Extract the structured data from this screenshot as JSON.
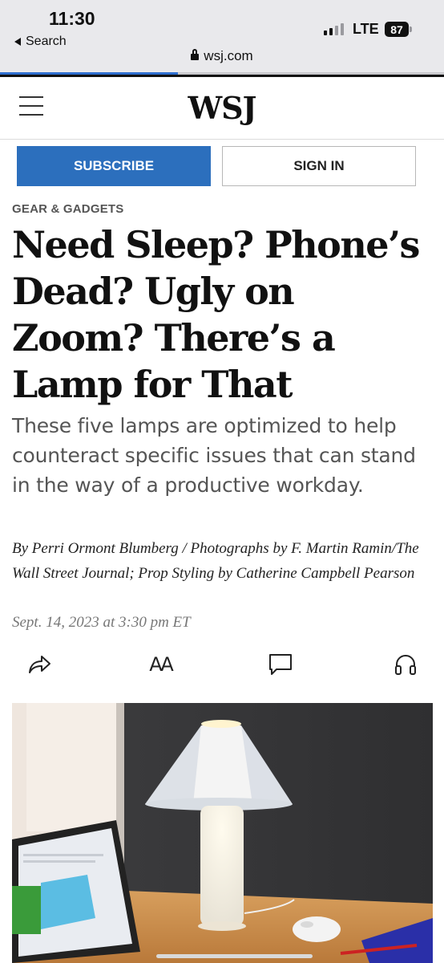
{
  "status_bar": {
    "time": "11:30",
    "back_label": "Search",
    "carrier": "LTE",
    "battery": "87"
  },
  "browser": {
    "url": "wsj.com",
    "load_progress": 0.4
  },
  "header": {
    "logo": "WSJ",
    "subscribe_label": "SUBSCRIBE",
    "signin_label": "SIGN IN"
  },
  "article": {
    "section": "GEAR & GADGETS",
    "headline": "Need Sleep? Phone’s Dead? Ugly on Zoom? There’s a Lamp for That",
    "dek": "These five lamps are optimized to help counteract specific issues that can stand in the way of a productive workday.",
    "byline": "By Perri Ormont Blumberg / Photographs by F. Martin Ramin/The Wall Street Journal; Prop Styling by Catherine Campbell Pearson",
    "date": "Sept. 14, 2023 at 3:30 pm ET",
    "font_tool": "AA"
  },
  "icons": {
    "share": "share-icon",
    "font_size": "text-size-icon",
    "comments": "comment-icon",
    "listen": "headphones-icon"
  },
  "colors": {
    "subscribe_bg": "#2c6fbd",
    "progress": "#2f6fd0",
    "text_dark": "#111111",
    "dek_gray": "#555555"
  }
}
